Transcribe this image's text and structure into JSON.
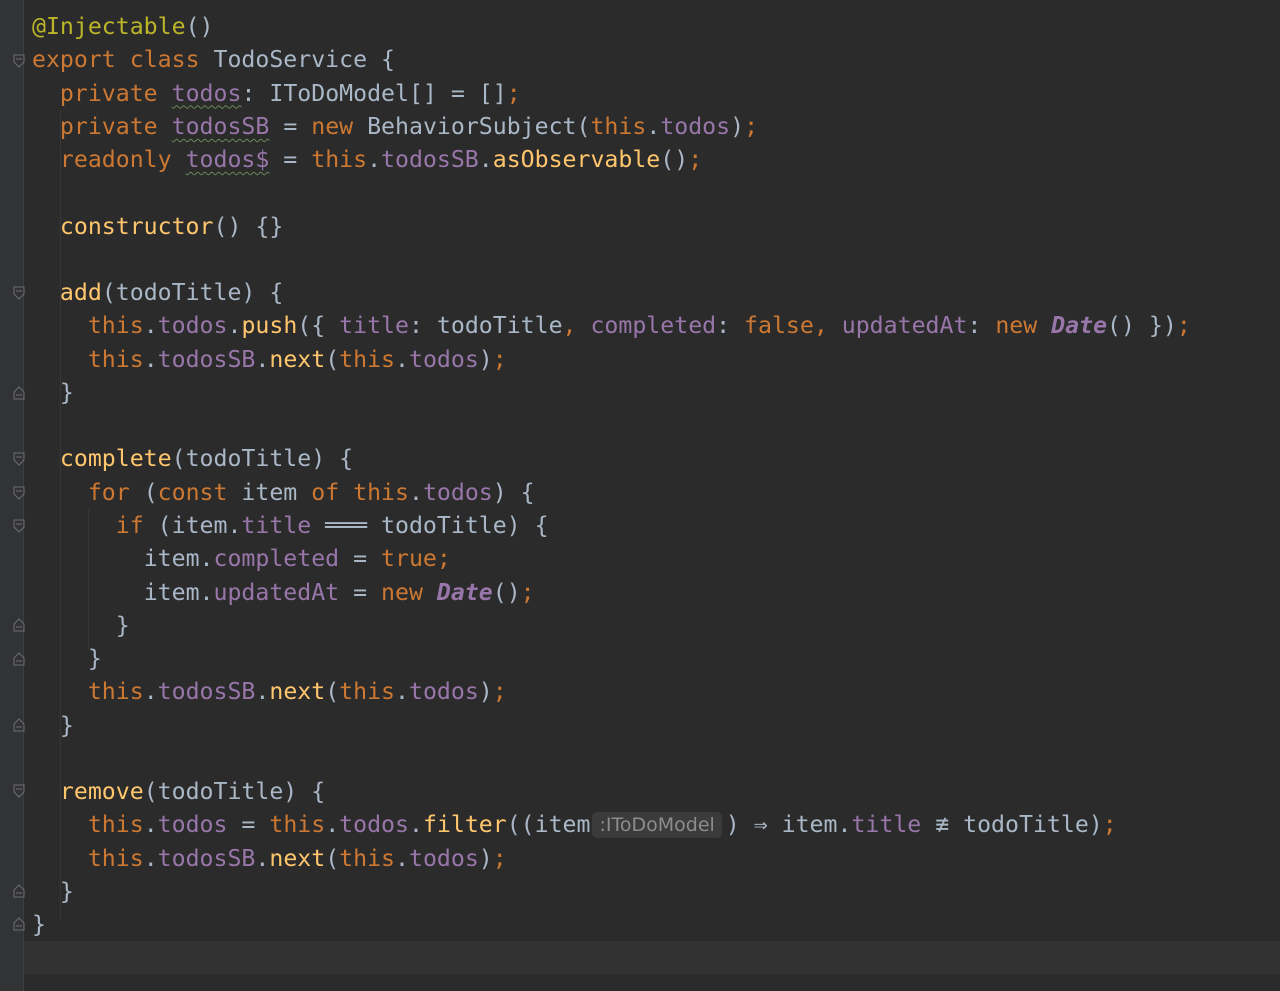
{
  "editor": {
    "theme_colors": {
      "background": "#2b2b2b",
      "text": "#a9b7c6",
      "keyword": "#cc7832",
      "field": "#9876aa",
      "function": "#ffc66d",
      "annotation": "#bbb529"
    },
    "code": {
      "l1": {
        "ann": "@Injectable",
        "p": "()"
      },
      "l2": {
        "kw1": "export",
        "kw2": "class",
        "name": " TodoService {"
      },
      "l3": {
        "kw": "private",
        "fld": "todos",
        "rest": ": IToDoModel[] = []",
        "semi": ";"
      },
      "l4": {
        "kw": "private",
        "fld": "todosSB",
        "eq": " = ",
        "new": "new",
        "cls": " BehaviorSubject(",
        "this": "this",
        "dot": ".",
        "fld2": "todos",
        "close": ")",
        "semi": ";"
      },
      "l5": {
        "kw": "readonly",
        "fld": "todos$",
        "eq": " = ",
        "this": "this",
        "dot": ".",
        "fld2": "todosSB",
        "dot2": ".",
        "fn": "asObservable",
        "p": "()",
        "semi": ";"
      },
      "l7": {
        "fn": "constructor",
        "rest": "() {}"
      },
      "l9": {
        "fn": "add",
        "rest": "(todoTitle) {"
      },
      "l10": {
        "this": "this",
        "dot": ".",
        "fld": "todos",
        "dot2": ".",
        "fn": "push",
        "open": "({ ",
        "k1": "title",
        "c1": ": todoTitle",
        "com1": ", ",
        "k2": "completed",
        "c2": ": ",
        "false": "false",
        "com2": ", ",
        "k3": "updatedAt",
        "c3": ": ",
        "new": "new",
        "sp": " ",
        "date": "Date",
        "close": "() })",
        "semi": ";"
      },
      "l11": {
        "this": "this",
        "dot": ".",
        "fld": "todosSB",
        "dot2": ".",
        "fn": "next",
        "open": "(",
        "this2": "this",
        "dot3": ".",
        "fld2": "todos",
        "close": ")",
        "semi": ";"
      },
      "l12": {
        "brace": "}"
      },
      "l14": {
        "fn": "complete",
        "rest": "(todoTitle) {"
      },
      "l15": {
        "for": "for",
        "open": " (",
        "const": "const",
        "item": " item ",
        "of": "of",
        "sp": " ",
        "this": "this",
        "dot": ".",
        "fld": "todos",
        "close": ") {"
      },
      "l16": {
        "if": "if",
        "open": " (item.",
        "fld": "title",
        "op": " ═══ ",
        "rest": "todoTitle) {"
      },
      "l17": {
        "item": "item.",
        "fld": "completed",
        "eq": " = ",
        "true": "true",
        "semi": ";"
      },
      "l18": {
        "item": "item.",
        "fld": "updatedAt",
        "eq": " = ",
        "new": "new",
        "sp": " ",
        "date": "Date",
        "p": "()",
        "semi": ";"
      },
      "l19": {
        "brace": "}"
      },
      "l20": {
        "brace": "}"
      },
      "l21": {
        "this": "this",
        "dot": ".",
        "fld": "todosSB",
        "dot2": ".",
        "fn": "next",
        "open": "(",
        "this2": "this",
        "dot3": ".",
        "fld2": "todos",
        "close": ")",
        "semi": ";"
      },
      "l22": {
        "brace": "}"
      },
      "l24": {
        "fn": "remove",
        "rest": "(todoTitle) {"
      },
      "l25": {
        "this": "this",
        "dot": ".",
        "fld": "todos",
        "eq": " = ",
        "this2": "this",
        "dot2": ".",
        "fld2": "todos",
        "dot3": ".",
        "fn": "filter",
        "open": "((item",
        "hint": ":IToDoModel",
        "arrow": ") ⇒ item.",
        "fld3": "title",
        "op": " ≢ ",
        "rest": "todoTitle)",
        "semi": ";"
      },
      "l26": {
        "this": "this",
        "dot": ".",
        "fld": "todosSB",
        "dot2": ".",
        "fn": "next",
        "open": "(",
        "this2": "this",
        "dot3": ".",
        "fld2": "todos",
        "close": ")",
        "semi": ";"
      },
      "l27": {
        "brace": "}"
      },
      "l28": {
        "brace": "}"
      }
    }
  }
}
